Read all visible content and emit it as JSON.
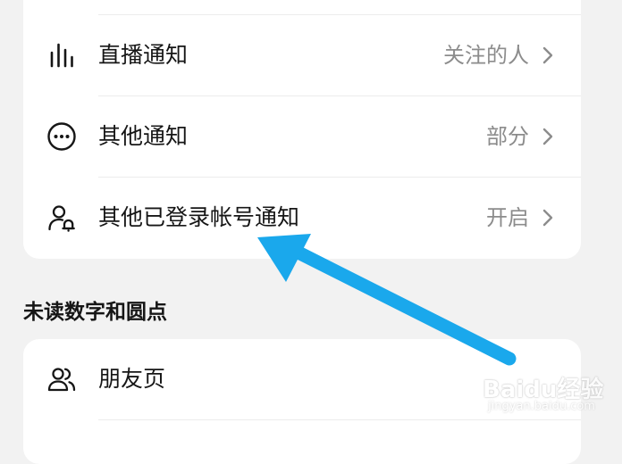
{
  "notifications": {
    "items": [
      {
        "label": "直播通知",
        "value": "关注的人",
        "icon": "bar-chart-icon"
      },
      {
        "label": "其他通知",
        "value": "部分",
        "icon": "more-circle-icon"
      },
      {
        "label": "其他已登录帐号通知",
        "value": "开启",
        "icon": "user-bell-icon"
      }
    ]
  },
  "unread_section": {
    "title": "未读数字和圆点",
    "items": [
      {
        "label": "朋友页",
        "icon": "friends-icon"
      }
    ]
  },
  "annotation": {
    "arrow_color": "#1aa8ec"
  },
  "watermark": {
    "logo": "Baidu经验",
    "url": "jingyan.baidu.com"
  }
}
